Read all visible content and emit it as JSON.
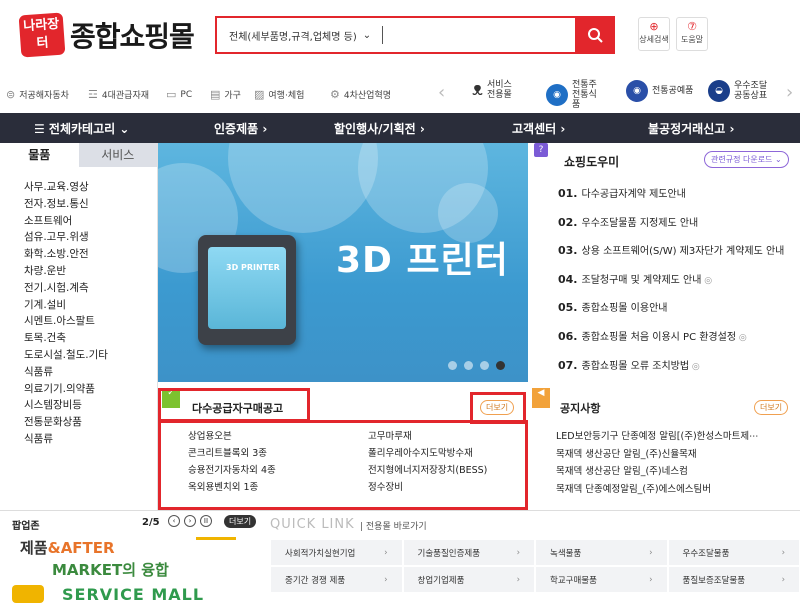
{
  "header": {
    "logo_badge": "나라장터",
    "logo_text": "종합쇼핑몰",
    "search": {
      "scope": "전체(세부품명,규격,업체명 등)",
      "placeholder": ""
    },
    "buttons": {
      "detail_search": "상세검색",
      "help": "도움말"
    }
  },
  "category_strip": {
    "links": [
      "저공해자동차",
      "4대관급자재",
      "PC",
      "가구",
      "여행·체험",
      "4차산업혁명"
    ],
    "services": [
      {
        "label": "서비스 전용몰",
        "color": "#333333"
      },
      {
        "label": "전통주 전통식품",
        "color": "#1f6fc5"
      },
      {
        "label": "전통공예품",
        "color": "#2a4fa8"
      },
      {
        "label": "우수조달 공동상표",
        "color": "#1a3e8a"
      }
    ]
  },
  "nav": {
    "all_categories": "☰ 전체카테고리 ⌄",
    "items": [
      "인증제품 ›",
      "할인행사/기획전 ›",
      "고객센터 ›",
      "불공정거래신고 ›"
    ]
  },
  "sidebar": {
    "tabs": [
      "물품",
      "서비스"
    ],
    "items": [
      "사무.교육.영상",
      "전자.정보.통신",
      "소프트웨어",
      "섬유.고무.위생",
      "화학.소방.안전",
      "차량.운반",
      "전기.시험.계측",
      "기계.설비",
      "시멘트.아스팔트",
      "토목.건축",
      "도로시설.철도.기타",
      "식품류",
      "의료기기.의약품",
      "시스템장비등",
      "전통문화상품",
      "식품류"
    ]
  },
  "banner": {
    "title": "3D 프린터",
    "printer_label": "3D PRINTER",
    "active_dot": 3
  },
  "helper": {
    "title": "쇼핑도우미",
    "download_button": "관련규정 다운로드 ⌄",
    "items": [
      {
        "num": "01.",
        "text": "다수공급자계약 제도안내"
      },
      {
        "num": "02.",
        "text": "우수조달물품 지정제도 안내"
      },
      {
        "num": "03.",
        "text": "상용 소프트웨어(S/W) 제3자단가 계약제도 안내"
      },
      {
        "num": "04.",
        "text": "조달청구매 및 계약제도 안내"
      },
      {
        "num": "05.",
        "text": "종합쇼핑몰 이용안내"
      },
      {
        "num": "06.",
        "text": "종합쇼핑몰 처음 이용시 PC 환경설정"
      },
      {
        "num": "07.",
        "text": "종합쇼핑몰 오류 조치방법"
      }
    ]
  },
  "tender": {
    "title": "다수공급자구매공고",
    "more": "더보기",
    "items": [
      "상업용오븐",
      "고무마루재",
      "콘크리트블록외 3종",
      "폴리우레아수지도막방수재",
      "승용전기자동차외 4종",
      "전지형에너지저장장치(BESS)",
      "옥외용벤치외 1종",
      "정수장비"
    ]
  },
  "notice": {
    "title": "공지사항",
    "more": "더보기",
    "items": [
      "LED보안등기구 단종예정 알림[(주)한성스마트제⋯",
      "목재덱 생산공단 알림_(주)신율목재",
      "목재덱 생산공단 알림_(주)네스컴",
      "목재덱 단종예정알림_(주)에스에스팀버"
    ]
  },
  "popupzone": {
    "title": "팝업존",
    "count": "2/5",
    "more": "더보기",
    "line1a": "제품",
    "line1b": "&AFTER",
    "line2": "MARKET의 융합",
    "line3": "SERVICE MALL"
  },
  "quicklink": {
    "title": "QUICK LINK",
    "subtitle": "| 전용몰 바로가기",
    "items": [
      "사회적가치실현기업",
      "기술품질인증제품",
      "녹색물품",
      "우수조달물품",
      "중기간 경쟁 제품",
      "창업기업제품",
      "학교구매물품",
      "품질보증조달물품"
    ]
  },
  "colors": {
    "brand_red": "#e2262c",
    "nav_bg": "#2a2d3a",
    "banner_blue": "#4aa8d8"
  }
}
